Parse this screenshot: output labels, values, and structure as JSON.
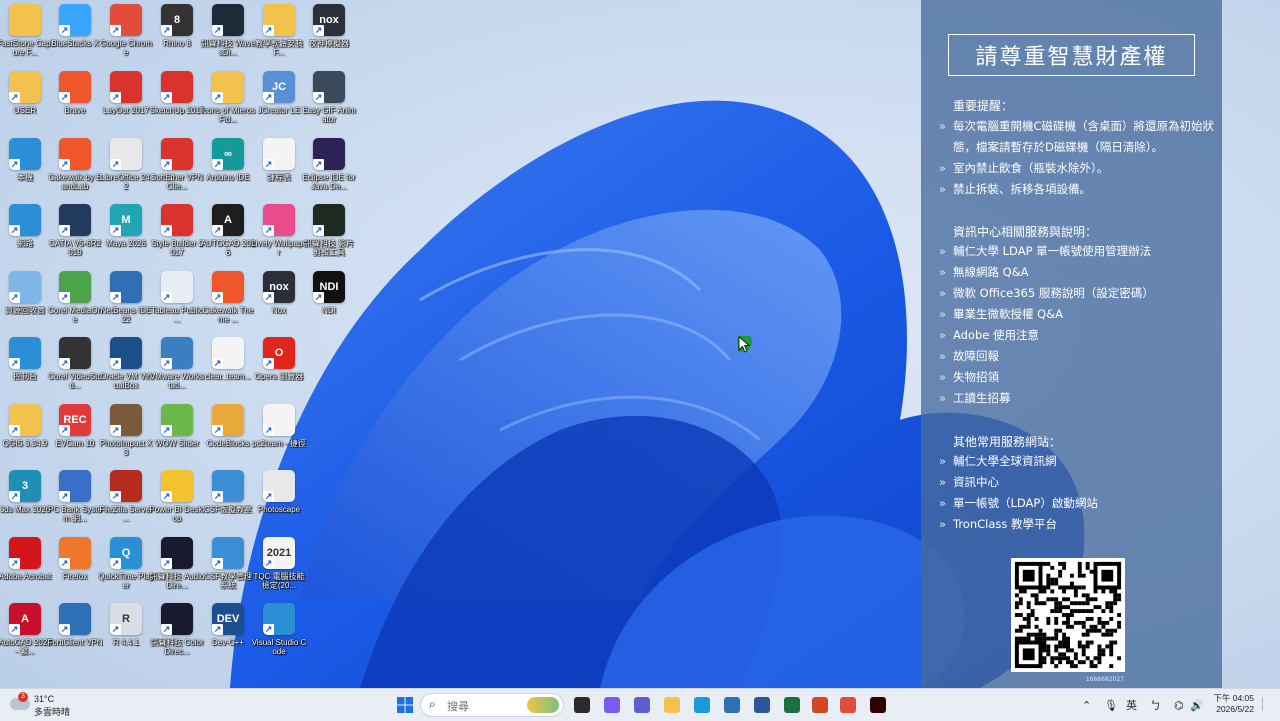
{
  "desktop_icons": [
    {
      "label": "FastStone Capture F...",
      "color": "#f2c14e",
      "glyph": "",
      "col": 0,
      "row": 0
    },
    {
      "label": "BlueStacks X",
      "color": "#3aa6ff",
      "glyph": "",
      "col": 1,
      "row": 0
    },
    {
      "label": "Google Chrome",
      "color": "#e24c3a",
      "glyph": "",
      "col": 2,
      "row": 0
    },
    {
      "label": "Rhino 8",
      "color": "#333333",
      "glyph": "8",
      "col": 3,
      "row": 0
    },
    {
      "label": "訊聲科技 WavesDi...",
      "color": "#1e2a38",
      "glyph": "",
      "col": 4,
      "row": 0
    },
    {
      "label": "教學軟體安裝 F...",
      "color": "#f2c14e",
      "glyph": "",
      "col": 5,
      "row": 0
    },
    {
      "label": "夜神模擬器",
      "color": "#2a2f3a",
      "glyph": "nox",
      "col": 6,
      "row": 0
    },
    {
      "label": "USER",
      "color": "#f2c14e",
      "glyph": "",
      "col": 0,
      "row": 1
    },
    {
      "label": "Brave",
      "color": "#f0562b",
      "glyph": "",
      "col": 1,
      "row": 1
    },
    {
      "label": "LayOut 2017",
      "color": "#d9332b",
      "glyph": "",
      "col": 2,
      "row": 1
    },
    {
      "label": "SketchUp 2017",
      "color": "#d9332b",
      "glyph": "",
      "col": 3,
      "row": 1
    },
    {
      "label": "Icons of Mieros Fid...",
      "color": "#f2c14e",
      "glyph": "",
      "col": 4,
      "row": 1
    },
    {
      "label": "JCreator LE",
      "color": "#5a8fd6",
      "glyph": "JC",
      "col": 5,
      "row": 1
    },
    {
      "label": "Easy GIF Animator",
      "color": "#3a4a5a",
      "glyph": "",
      "col": 6,
      "row": 1
    },
    {
      "label": "本機",
      "color": "#2b8fd6",
      "glyph": "",
      "col": 0,
      "row": 2
    },
    {
      "label": "Cakewalk by BandLab",
      "color": "#f0562b",
      "glyph": "",
      "col": 1,
      "row": 2
    },
    {
      "label": "LibreOffice 24.2",
      "color": "#e8e8e8",
      "glyph": "",
      "col": 2,
      "row": 2
    },
    {
      "label": "SoftEther VPN Clie...",
      "color": "#d9332b",
      "glyph": "",
      "col": 3,
      "row": 2
    },
    {
      "label": "Arduino IDE",
      "color": "#159a9c",
      "glyph": "∞",
      "col": 4,
      "row": 2
    },
    {
      "label": "課程表",
      "color": "#f4f4f4",
      "glyph": "",
      "col": 5,
      "row": 2
    },
    {
      "label": "Eclipse IDE for Java De...",
      "color": "#2c2255",
      "glyph": "",
      "col": 6,
      "row": 2
    },
    {
      "label": "網路",
      "color": "#2b8fd6",
      "glyph": "",
      "col": 0,
      "row": 3
    },
    {
      "label": "CATIA V5-6R2019",
      "color": "#223a5e",
      "glyph": "",
      "col": 1,
      "row": 3
    },
    {
      "label": "Maya 2026",
      "color": "#1fa5b5",
      "glyph": "M",
      "col": 2,
      "row": 3
    },
    {
      "label": "Style Builder 2017",
      "color": "#d9332b",
      "glyph": "",
      "col": 3,
      "row": 3
    },
    {
      "label": "AUTOCAD 2026",
      "color": "#1e1e1e",
      "glyph": "A",
      "col": 4,
      "row": 3
    },
    {
      "label": "Lively Wallpaper",
      "color": "#e84c8a",
      "glyph": "",
      "col": 5,
      "row": 3
    },
    {
      "label": "訊聲科技 影片 剪輯工具",
      "color": "#1e2a20",
      "glyph": "",
      "col": 6,
      "row": 3
    },
    {
      "label": "資源回收筒",
      "color": "#7fb6e8",
      "glyph": "",
      "col": 0,
      "row": 4
    },
    {
      "label": "Corel MediaOne",
      "color": "#4ba34b",
      "glyph": "",
      "col": 1,
      "row": 4
    },
    {
      "label": "NetBeans IDE 22",
      "color": "#2f6fb5",
      "glyph": "",
      "col": 2,
      "row": 4
    },
    {
      "label": "Tableau Public ...",
      "color": "#e8edf3",
      "glyph": "",
      "col": 3,
      "row": 4
    },
    {
      "label": "Cakewalk Theme ...",
      "color": "#f0562b",
      "glyph": "",
      "col": 4,
      "row": 4
    },
    {
      "label": "Nox",
      "color": "#2a2f3a",
      "glyph": "nox",
      "col": 5,
      "row": 4
    },
    {
      "label": "NDI",
      "color": "#111111",
      "glyph": "NDI",
      "col": 6,
      "row": 4
    },
    {
      "label": "控制台",
      "color": "#2b8fd6",
      "glyph": "",
      "col": 0,
      "row": 5
    },
    {
      "label": "Corel VideoStud...",
      "color": "#333333",
      "glyph": "",
      "col": 1,
      "row": 5
    },
    {
      "label": "Oracle VM VirtualBox",
      "color": "#1b4f8a",
      "glyph": "",
      "col": 2,
      "row": 5
    },
    {
      "label": "VMware Workstati...",
      "color": "#3a7fc2",
      "glyph": "",
      "col": 3,
      "row": 5
    },
    {
      "label": "clear_team...",
      "color": "#f4f4f4",
      "glyph": "",
      "col": 4,
      "row": 5
    },
    {
      "label": "Opera 瀏覽器",
      "color": "#e0251b",
      "glyph": "O",
      "col": 5,
      "row": 5
    },
    {
      "label": "QGIS 3.34.9",
      "color": "#f2c14e",
      "glyph": "",
      "col": 0,
      "row": 6
    },
    {
      "label": "EVCam 10",
      "color": "#e03a3a",
      "glyph": "REC",
      "col": 1,
      "row": 6
    },
    {
      "label": "PhotoImpact X3",
      "color": "#7a5a3a",
      "glyph": "",
      "col": 2,
      "row": 6
    },
    {
      "label": "WOW Slider",
      "color": "#6bb84a",
      "glyph": "",
      "col": 3,
      "row": 6
    },
    {
      "label": "CodeBlocks",
      "color": "#e8a93a",
      "glyph": "",
      "col": 4,
      "row": 6
    },
    {
      "label": "pc2team - 捷徑",
      "color": "#f4f4f4",
      "glyph": "",
      "col": 5,
      "row": 6
    },
    {
      "label": "3ds Max 2026",
      "color": "#1f8fb5",
      "glyph": "3",
      "col": 0,
      "row": 7
    },
    {
      "label": "PC Bank System 網...",
      "color": "#3a6ec9",
      "glyph": "",
      "col": 1,
      "row": 7
    },
    {
      "label": "FileZilla Server ...",
      "color": "#b52b1f",
      "glyph": "",
      "col": 2,
      "row": 7
    },
    {
      "label": "Power BI Desktop",
      "color": "#f2c230",
      "glyph": "",
      "col": 3,
      "row": 7
    },
    {
      "label": "CSF虛擬教室",
      "color": "#3a8fd6",
      "glyph": "",
      "col": 4,
      "row": 7
    },
    {
      "label": "Photoscape",
      "color": "#e8e8e8",
      "glyph": "",
      "col": 5,
      "row": 7
    },
    {
      "label": "Adobe Acrobat",
      "color": "#d4161c",
      "glyph": "",
      "col": 0,
      "row": 8
    },
    {
      "label": "Firefox",
      "color": "#f0762b",
      "glyph": "",
      "col": 1,
      "row": 8
    },
    {
      "label": "QuickTime Player",
      "color": "#2b8fd6",
      "glyph": "Q",
      "col": 2,
      "row": 8
    },
    {
      "label": "訊聲科技 AudioDire...",
      "color": "#1a1a2e",
      "glyph": "",
      "col": 3,
      "row": 8
    },
    {
      "label": "CSF教學管理 系統",
      "color": "#3a8fd6",
      "glyph": "",
      "col": 4,
      "row": 8
    },
    {
      "label": "TQC 電腦技能 檢定(20...",
      "color": "#f4f4f4",
      "glyph": "2021",
      "col": 5,
      "row": 8
    },
    {
      "label": "AutoCAD 2026 - 繁...",
      "color": "#c8102e",
      "glyph": "A",
      "col": 0,
      "row": 9
    },
    {
      "label": "FortiClient VPN",
      "color": "#2f6fb5",
      "glyph": "",
      "col": 1,
      "row": 9
    },
    {
      "label": "R 4.4.1",
      "color": "#d8dde6",
      "glyph": "R",
      "col": 2,
      "row": 9
    },
    {
      "label": "訊聲科技 ColorDirec...",
      "color": "#1a1a2e",
      "glyph": "",
      "col": 3,
      "row": 9
    },
    {
      "label": "Dev-C++",
      "color": "#1c4f8e",
      "glyph": "DEV",
      "col": 4,
      "row": 9
    },
    {
      "label": "Visual Studio Code",
      "color": "#2b8fd6",
      "glyph": "",
      "col": 5,
      "row": 9
    }
  ],
  "notice": {
    "title": "請尊重智慧財產權",
    "section1_head": "重要提醒：",
    "section1_items": [
      "每次電腦重開機C磁碟機（含桌面）將還原為初始狀態，檔案請暫存於D磁碟機（隔日清除）。",
      "室內禁止飲食（瓶裝水除外）。",
      "禁止拆裝、拆移各項設備。"
    ],
    "section2_head": "資訊中心相關服務與說明：",
    "section2_items": [
      "輔仁大學 LDAP 單一帳號使用管理辦法",
      "無線網路 Q&A",
      "微軟 Office365 服務說明（設定密碼）",
      "畢業生微軟授權 Q&A",
      "Adobe 使用注意",
      "故障回報",
      "失物招領",
      "工讀生招募"
    ],
    "section3_head": "其他常用服務網站：",
    "section3_items": [
      "輔仁大學全球資訊網",
      "資訊中心",
      "單一帳號（LDAP）啟動網站",
      "TronClass 教學平台"
    ],
    "qr_code_number": "1668682027"
  },
  "taskbar": {
    "weather_badge": "3",
    "weather_temp": "31°C",
    "weather_desc": "多雲時晴",
    "search_placeholder": "搜尋",
    "apps": [
      {
        "name": "start",
        "color": "#1f6fe0"
      },
      {
        "name": "task-view",
        "color": "#2b2b2b"
      },
      {
        "name": "copilot",
        "color": "#7a5af0"
      },
      {
        "name": "teams",
        "color": "#5a5fcf"
      },
      {
        "name": "file-explorer",
        "color": "#f2c14e"
      },
      {
        "name": "edge",
        "color": "#1a9ad6"
      },
      {
        "name": "store",
        "color": "#2f6fb5"
      },
      {
        "name": "word",
        "color": "#2b579a"
      },
      {
        "name": "excel",
        "color": "#1d7044"
      },
      {
        "name": "powerpoint",
        "color": "#d24726"
      },
      {
        "name": "chrome",
        "color": "#e24c3a"
      },
      {
        "name": "illustrator",
        "color": "#330000"
      }
    ],
    "tray_lang": "英",
    "clock_time": "下午 04:05",
    "clock_date": "2026/5/22"
  }
}
